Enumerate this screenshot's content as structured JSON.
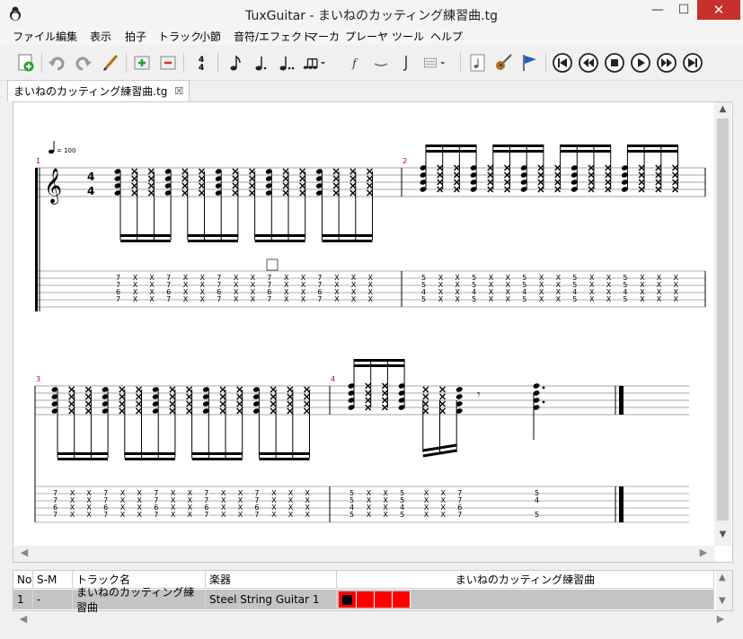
{
  "window": {
    "title": "TuxGuitar - まいねのカッティング練習曲.tg",
    "minimize_glyph": "—",
    "maximize_glyph": "☐",
    "close_glyph": "✕"
  },
  "menu": [
    "ファイル",
    "編集",
    "表示",
    "拍子",
    "トラック",
    "小節",
    "音符/エフェクト",
    "マーカ",
    "プレーヤ",
    "ツール",
    "ヘルプ"
  ],
  "toolbar": {
    "icons": [
      "new-file-icon",
      "undo-icon",
      "redo-icon",
      "edit-pen-icon",
      "add-measure-icon",
      "remove-measure-icon",
      "time-signature-icon",
      "eighth-note-icon",
      "dotted-note-icon",
      "double-dotted-note-icon",
      "tuplet-icon",
      "dynamics-icon",
      "tie-icon",
      "rest-icon",
      "track-dropdown-icon",
      "instrument-note-icon",
      "guitar-icon",
      "marker-flag-icon",
      "first-icon",
      "previous-icon",
      "stop-icon",
      "play-icon",
      "next-icon",
      "last-icon"
    ]
  },
  "document_tab": {
    "label": "まいねのカッティング練習曲.tg",
    "close_glyph": "☒"
  },
  "score": {
    "tempo_label": "= 100",
    "time_signature": {
      "top": "4",
      "bottom": "4"
    },
    "measure_numbers": [
      "1",
      "2",
      "3",
      "4"
    ],
    "tab_groups": {
      "m1": [
        "7\n7\n6\n7",
        "X\nX\nX\nX",
        "X\nX\nX\nX",
        "7\n7\n6\n7",
        "X\nX\nX\nX",
        "X\nX\nX\nX",
        "7\n7\n6\n7",
        "X\nX\nX\nX",
        "X\nX\nX\nX",
        "7\n7\n6\n7",
        "X\nX\nX\nX",
        "X\nX\nX\nX",
        "7\n7\n6\n7",
        "X\nX\nX\nX",
        "X\nX\nX\nX",
        "X\nX\nX\nX"
      ],
      "m2": [
        "5\n5\n4\n5",
        "X\nX\nX\nX",
        "X\nX\nX\nX",
        "5\n5\n4\n5",
        "X\nX\nX\nX",
        "X\nX\nX\nX",
        "5\n5\n4\n5",
        "X\nX\nX\nX",
        "X\nX\nX\nX",
        "5\n5\n4\n5",
        "X\nX\nX\nX",
        "X\nX\nX\nX",
        "5\n5\n4\n5",
        "X\nX\nX\nX",
        "X\nX\nX\nX",
        "X\nX\nX\nX"
      ],
      "m3": [
        "7\n7\n6\n7",
        "X\nX\nX\nX",
        "X\nX\nX\nX",
        "7\n7\n6\n7",
        "X\nX\nX\nX",
        "X\nX\nX\nX",
        "7\n7\n6\n7",
        "X\nX\nX\nX",
        "X\nX\nX\nX",
        "7\n7\n6\n7",
        "X\nX\nX\nX",
        "X\nX\nX\nX",
        "7\n7\n6\n7",
        "X\nX\nX\nX",
        "X\nX\nX\nX",
        "X\nX\nX\nX"
      ],
      "m4": [
        "5\n5\n4\n5",
        "X\nX\nX\nX",
        "X\nX\nX\nX",
        "5\n5\n4\n5",
        "X\nX\nX\nX",
        "X\nX\nX\nX",
        "7\n7\n6\n7",
        "5\n4\n\n5"
      ]
    }
  },
  "track_table": {
    "headers": {
      "no": "No",
      "sm": "S-M",
      "name": "トラック名",
      "instrument": "楽器",
      "song": "まいねのカッティング練習曲"
    },
    "rows": [
      {
        "no": "1",
        "sm": "-",
        "name": "まいねのカッティング練習曲",
        "instrument": "Steel String Guitar 1",
        "measures": 4
      }
    ]
  },
  "colors": {
    "measure_cell": "#ff0000",
    "selected_row": "#c4c4c4",
    "measure_number": "#cc0000"
  }
}
